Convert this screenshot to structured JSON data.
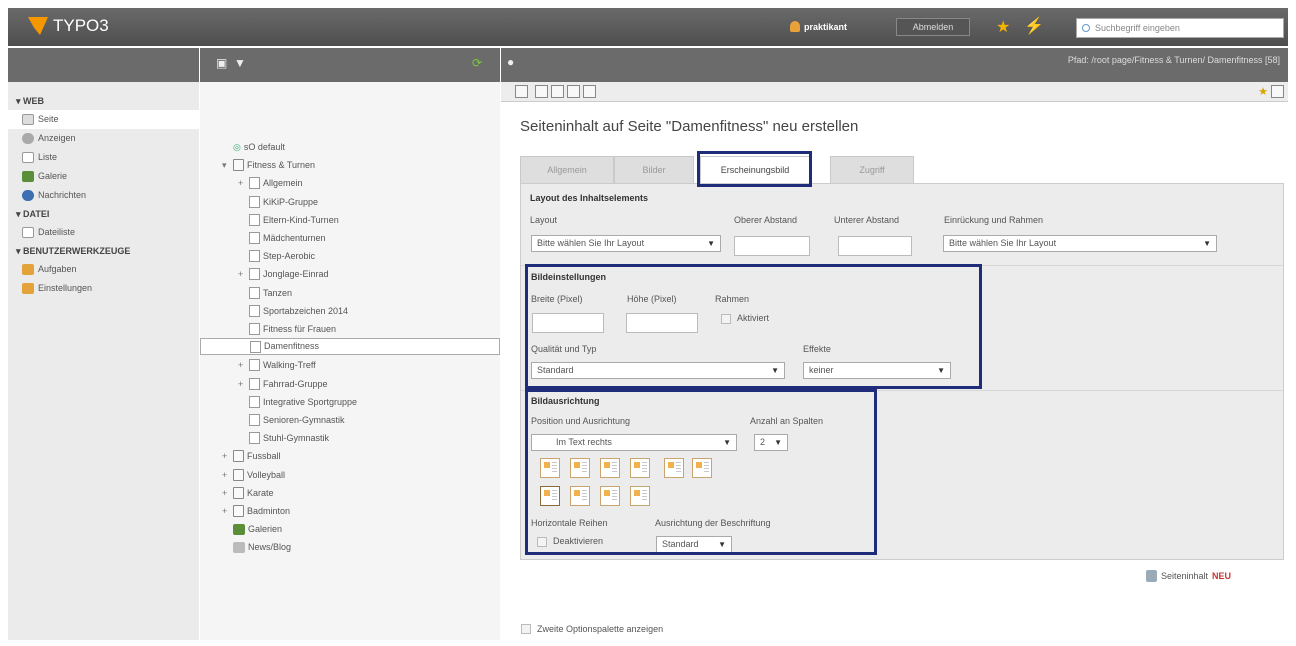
{
  "app": {
    "logo": "TYPO3"
  },
  "topbar": {
    "username": "praktikant",
    "logout_label": "Abmelden",
    "search_placeholder": "Suchbegriff eingeben"
  },
  "path": "Pfad: /root page/Fitness & Turnen/ Damenfitness [58]",
  "menu": {
    "groups": [
      {
        "label": "▾ WEB",
        "items": [
          "Seite",
          "Anzeigen",
          "Liste",
          "Galerie",
          "Nachrichten"
        ]
      },
      {
        "label": "▾ DATEI",
        "items": [
          "Dateiliste"
        ]
      },
      {
        "label": "▾ BENUTZERWERKZEUGE",
        "items": [
          "Aufgaben",
          "Einstellungen"
        ]
      }
    ]
  },
  "tree": {
    "root": "sO default",
    "items": [
      "Fitness & Turnen",
      "Allgemein",
      "KiKiP-Gruppe",
      "Eltern-Kind-Turnen",
      "Mädchenturnen",
      "Step-Aerobic",
      "Jonglage-Einrad",
      "Tanzen",
      "Sportabzeichen 2014",
      "Fitness für Frauen",
      "Damenfitness",
      "Walking-Treff",
      "Fahrrad-Gruppe",
      "Integrative Sportgruppe",
      "Senioren-Gymnastik",
      "Stuhl-Gymnastik",
      "Fussball",
      "Volleyball",
      "Karate",
      "Badminton",
      "Galerien",
      "News/Blog"
    ]
  },
  "main": {
    "title": "Seiteninhalt auf Seite \"Damenfitness\" neu erstellen",
    "tabs": [
      "Allgemein",
      "Bilder",
      "Erscheinungsbild",
      "Zugriff"
    ],
    "layout_section": {
      "title": "Layout des Inhaltselements",
      "layout_label": "Layout",
      "layout_value": "Bitte wählen Sie Ihr Layout",
      "space_before_label": "Oberer Abstand",
      "space_after_label": "Unterer Abstand",
      "indent_label": "Einrückung und Rahmen",
      "indent_value": "Bitte wählen Sie Ihr Layout"
    },
    "image_settings": {
      "title": "Bildeinstellungen",
      "width_label": "Breite (Pixel)",
      "height_label": "Höhe (Pixel)",
      "frame_label": "Rahmen",
      "frame_checkbox": "Aktiviert",
      "quality_label": "Qualität und Typ",
      "quality_value": "Standard",
      "effects_label": "Effekte",
      "effects_value": "keiner"
    },
    "image_alignment": {
      "title": "Bildausrichtung",
      "position_label": "Position und Ausrichtung",
      "position_value": "Im Text rechts",
      "columns_label": "Anzahl an Spalten",
      "columns_value": "2",
      "horizontal_rows_label": "Horizontale Reihen",
      "deactivate_label": "Deaktivieren",
      "caption_align_label": "Ausrichtung der Beschriftung",
      "caption_align_value": "Standard"
    },
    "new_content_label": "Seiteninhalt",
    "new_badge": "NEU",
    "second_palette_label": "Zweite Optionspalette anzeigen"
  },
  "colors": {
    "highlight": "#1f2c7a",
    "topbar": "#5a5a5a",
    "accent": "#f49700"
  }
}
